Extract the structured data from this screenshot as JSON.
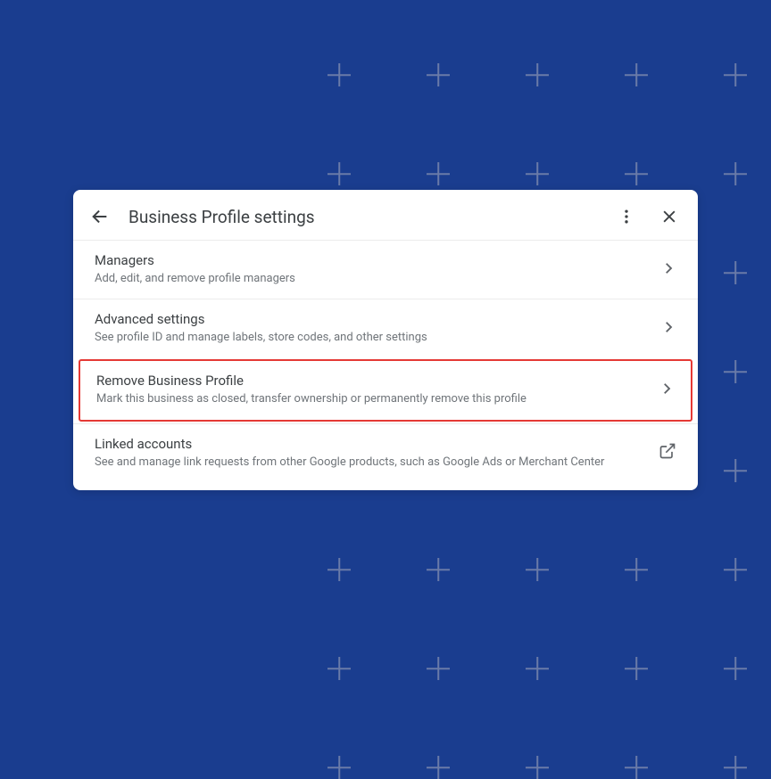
{
  "card": {
    "title": "Business Profile settings"
  },
  "items": [
    {
      "title": "Managers",
      "desc": "Add, edit, and remove profile managers"
    },
    {
      "title": "Advanced settings",
      "desc": "See profile ID and manage labels, store codes, and other settings"
    },
    {
      "title": "Remove Business Profile",
      "desc": "Mark this business as closed, transfer ownership or permanently remove this profile"
    },
    {
      "title": "Linked accounts",
      "desc": "See and manage link requests from other Google products, such as Google Ads or Merchant Center"
    }
  ]
}
